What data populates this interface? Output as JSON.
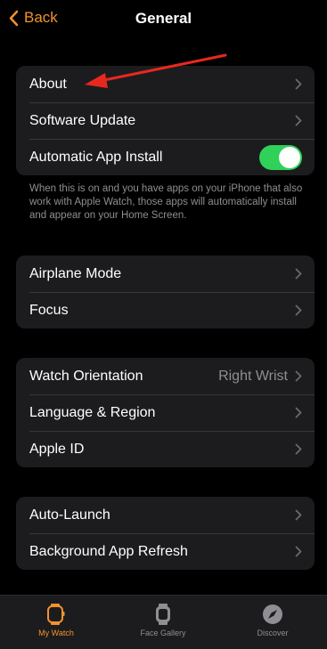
{
  "nav": {
    "back_label": "Back",
    "title": "General"
  },
  "group1": [
    {
      "label": "About"
    },
    {
      "label": "Software Update"
    },
    {
      "label": "Automatic App Install",
      "toggle": true
    }
  ],
  "footnote": "When this is on and you have apps on your iPhone that also work with Apple Watch, those apps will automatically install and appear on your Home Screen.",
  "group2": [
    {
      "label": "Airplane Mode"
    },
    {
      "label": "Focus"
    }
  ],
  "group3": [
    {
      "label": "Watch Orientation",
      "value": "Right Wrist"
    },
    {
      "label": "Language & Region"
    },
    {
      "label": "Apple ID"
    }
  ],
  "group4": [
    {
      "label": "Auto-Launch"
    },
    {
      "label": "Background App Refresh"
    }
  ],
  "tabs": [
    {
      "label": "My Watch",
      "icon": "watch-icon",
      "active": true
    },
    {
      "label": "Face Gallery",
      "icon": "face-gallery-icon",
      "active": false
    },
    {
      "label": "Discover",
      "icon": "compass-icon",
      "active": false
    }
  ],
  "colors": {
    "accent": "#f0932e",
    "toggle_on": "#30d158",
    "annotation": "#e8281f"
  }
}
